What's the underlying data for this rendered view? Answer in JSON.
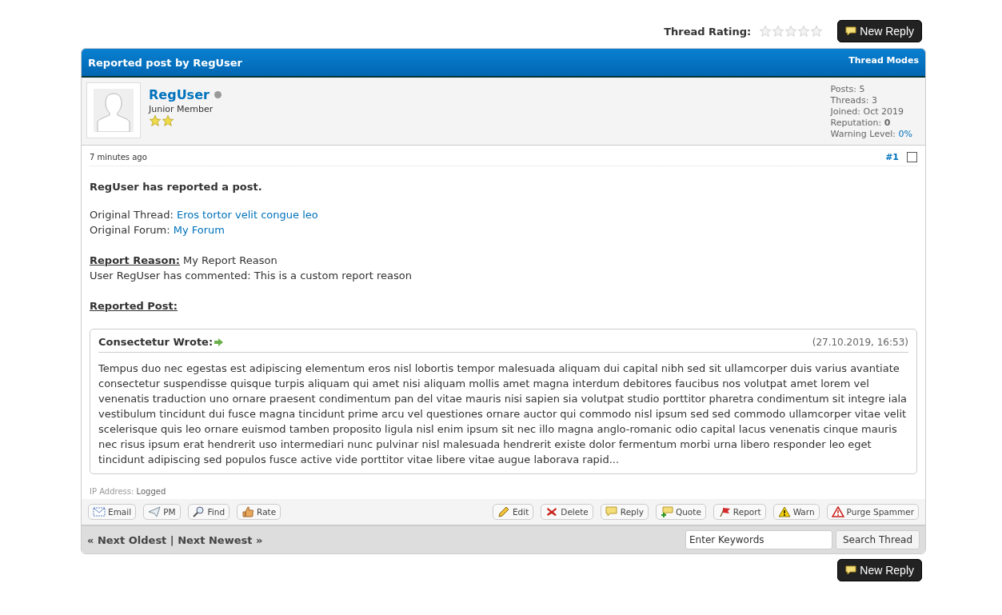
{
  "thread_rating": {
    "label": "Thread Rating:",
    "stars": 0
  },
  "new_reply_top": "New Reply",
  "post": {
    "header_title": "Reported post by RegUser",
    "thread_modes": "Thread Modes",
    "author": {
      "name": "RegUser",
      "online": false,
      "rank": "Junior Member",
      "stats": [
        "Posts: 5",
        "Threads: 3",
        "Joined: Oct 2019",
        "Reputation: **0**"
      ],
      "warning_label": "Warning Level:",
      "warning_value": "0%"
    },
    "time": "7 minutes ago",
    "number": "#1",
    "checked": false,
    "heading": "RegUser has reported a post.",
    "thread_label": "Original Thread:",
    "thread_link": "Eros tortor velit congue leo",
    "forum_label": "Original Forum:",
    "forum_link": "My Forum",
    "reason_label": "Report Reason:",
    "reason_text": "My Report Reason",
    "comment": "User RegUser has commented: This is a custom report reason",
    "reported_label": "Reported Post:",
    "quote": {
      "author": "Consectetur Wrote:",
      "date": "(27.10.2019, 16:53)",
      "text": "Tempus duo nec egestas est adipiscing elementum eros nisl lobortis tempor malesuada aliquam dui capital nibh sed sit ullamcorper duis varius avantiate consectetur suspendisse quisque turpis aliquam qui amet nisi aliquam mollis amet magna interdum debitores faucibus nos volutpat amet lorem vel venenatis traduction uno ornare praesent condimentum pan del vitae mauris nisi sapien sia volutpat studio porttitor pharetra condimentum sit integre iala vestibulum tincidunt dui fusce magna tincidunt prime arcu vel questiones ornare auctor qui commodo nisl ipsum sed sed commodo ullamcorper vitae velit scelerisque quis leo ornare euismod tamben proposito ligula nisl enim ipsum sit nec illo magna anglo-romanic odio capital lacus venenatis cinque mauris nec risus ipsum erat hendrerit uso intermediari nunc pulvinar nisl malesuada hendrerit existe dolor fermentum morbi urna libero responder leo eget tincidunt adipiscing sed populos fusce active vide porttitor vitae libere vitae augue laborava rapid..."
    },
    "ip_label": "IP Address:",
    "ip_value": "Logged",
    "left_buttons": [
      {
        "kind": "email",
        "label": "Email"
      },
      {
        "kind": "pm",
        "label": "PM"
      },
      {
        "kind": "find",
        "label": "Find"
      },
      {
        "kind": "rate",
        "label": "Rate"
      }
    ],
    "right_buttons": [
      {
        "kind": "edit",
        "label": "Edit"
      },
      {
        "kind": "delete",
        "label": "Delete"
      },
      {
        "kind": "reply",
        "label": "Reply"
      },
      {
        "kind": "quote",
        "label": "Quote"
      },
      {
        "kind": "report",
        "label": "Report"
      },
      {
        "kind": "warn",
        "label": "Warn"
      },
      {
        "kind": "purge",
        "label": "Purge Spammer"
      }
    ]
  },
  "nav": {
    "prev": "« Next Oldest",
    "separator": "|",
    "next": "Next Newest »"
  },
  "search": {
    "placeholder": "Enter Keywords",
    "button": "Search Thread"
  },
  "new_reply_bottom": "New Reply"
}
